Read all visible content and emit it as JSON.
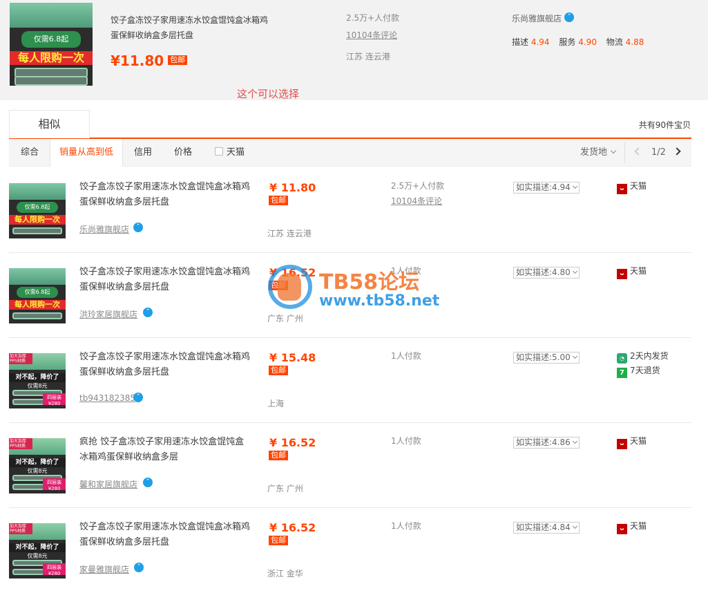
{
  "top_item": {
    "image_text_price_line": "仅需6.8起",
    "image_text_band": "每人限购一次",
    "title": "饺子盒冻饺子家用速冻水饺盒馄饨盒冰箱鸡蛋保鲜收纳盒多层托盘",
    "price": "¥11.80",
    "free_shipping": "包邮",
    "sales": "2.5万+人付款",
    "reviews": "10104条评论",
    "location": "江苏 连云港",
    "shop": "乐尚雅旗舰店",
    "scores": [
      {
        "label": "描述",
        "value": "4.94"
      },
      {
        "label": "服务",
        "value": "4.90"
      },
      {
        "label": "物流",
        "value": "4.88"
      }
    ]
  },
  "annotation": "这个可以选择",
  "tabs": {
    "similar": "相似",
    "total": "共有90件宝贝"
  },
  "sort": {
    "items": [
      "综合",
      "销量从高到低",
      "信用",
      "价格"
    ],
    "active": "销量从高到低",
    "tmall_filter": "天猫",
    "ship_from": "发货地",
    "page": "1/2"
  },
  "rows": [
    {
      "title": "饺子盒冻饺子家用速冻水饺盒馄饨盒冰箱鸡蛋保鲜收纳盒多层托盘",
      "shop": "乐尚雅旗舰店",
      "price": "¥ 11.80",
      "free": "包邮",
      "location": "江苏 连云港",
      "sales": "2.5万+人付款",
      "reviews": "10104条评论",
      "desc": "如实描述:4.94",
      "tags": [
        "天猫"
      ],
      "img_band": "每人限购一次",
      "img_price": "仅需6.8起"
    },
    {
      "title": "饺子盒冻饺子家用速冻水饺盒馄饨盒冰箱鸡蛋保鲜收纳盒多层托盘",
      "shop": "洪玲家居旗舰店",
      "price": "¥ 16.52",
      "free": "包邮",
      "location": "广东 广州",
      "sales": "1人付款",
      "reviews": "",
      "desc": "如实描述:4.80",
      "tags": [
        "天猫"
      ],
      "img_band": "每人限购一次",
      "img_price": "仅需6.8起"
    },
    {
      "title": "饺子盒冻饺子家用速冻水饺盒馄饨盒冰箱鸡蛋保鲜收纳盒多层托盘",
      "shop": "tb943182385",
      "price": "¥ 15.48",
      "free": "包邮",
      "location": "上海",
      "sales": "1人付款",
      "reviews": "",
      "desc": "如实描述:5.00",
      "tags": [
        "2天内发货",
        "7天退货"
      ],
      "img_band": "对不起，降价了",
      "img_price": "仅需8元",
      "img_corner": "加大加厚PP5材质",
      "img_pink": "四层装 ¥280"
    },
    {
      "title": "疯抢 饺子盒冻饺子家用速冻水饺盒馄饨盒冰箱鸡蛋保鲜收纳盒多层",
      "shop": "馨和家居旗舰店",
      "price": "¥ 16.52",
      "free": "包邮",
      "location": "广东 广州",
      "sales": "1人付款",
      "reviews": "",
      "desc": "如实描述:4.86",
      "tags": [
        "天猫"
      ],
      "img_band": "对不起，降价了",
      "img_price": "仅需8元",
      "img_corner": "加大加厚PP5材质",
      "img_pink": "四层装 ¥280"
    },
    {
      "title": "饺子盒冻饺子家用速冻水饺盒馄饨盒冰箱鸡蛋保鲜收纳盒多层托盘",
      "shop": "家曼雅旗舰店",
      "price": "¥ 16.52",
      "free": "包邮",
      "location": "浙江 金华",
      "sales": "1人付款",
      "reviews": "",
      "desc": "如实描述:4.84",
      "tags": [
        "天猫"
      ],
      "img_band": "对不起，降价了",
      "img_price": "仅需8元",
      "img_corner": "加大加厚PP5材质",
      "img_pink": "四层装 ¥280"
    }
  ],
  "watermark": {
    "title": "TB58论坛",
    "url": "www.tb58.net"
  },
  "colors": {
    "accent": "#ff4400",
    "tmall": "#c40000",
    "wangwang": "#1f9fe8"
  }
}
